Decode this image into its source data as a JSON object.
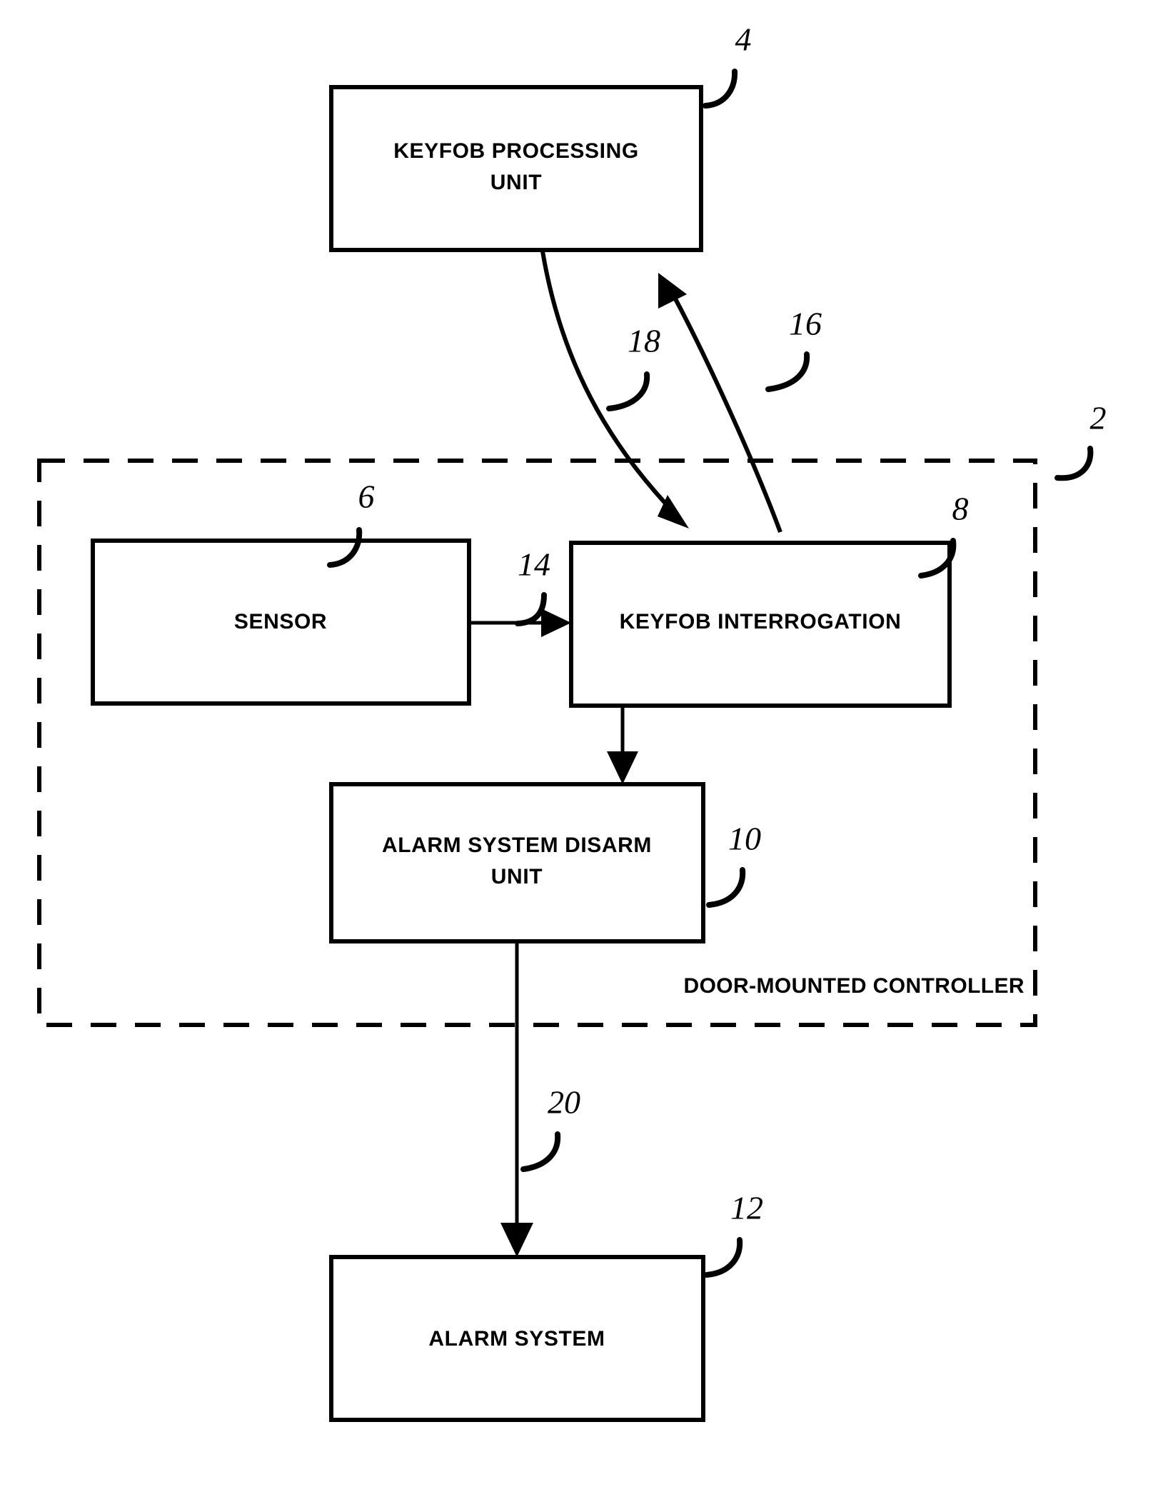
{
  "figure": {
    "type": "patent-block-diagram",
    "background_color": "#ffffff",
    "line_color": "#000000"
  },
  "boxes": [
    {
      "id": "keyfob-processing-unit",
      "label_line1": "KEYFOB PROCESSING",
      "label_line2": "UNIT",
      "ref": "4"
    },
    {
      "id": "sensor",
      "label_line1": "SENSOR",
      "label_line2": "",
      "ref": "6"
    },
    {
      "id": "keyfob-interrogation",
      "label_line1": "KEYFOB INTERROGATION",
      "label_line2": "",
      "ref": "8"
    },
    {
      "id": "alarm-system-disarm-unit",
      "label_line1": "ALARM SYSTEM DISARM",
      "label_line2": "UNIT",
      "ref": "10"
    },
    {
      "id": "alarm-system",
      "label_line1": "ALARM SYSTEM",
      "label_line2": "",
      "ref": "12"
    }
  ],
  "group": {
    "id": "door-mounted-controller",
    "label": "DOOR-MOUNTED CONTROLLER",
    "ref": "2",
    "style": "dashed"
  },
  "connectors": [
    {
      "id": "sensor-to-interrogation",
      "ref": "14",
      "from": "sensor",
      "to": "keyfob-interrogation",
      "style": "straight-arrow",
      "direction": "right"
    },
    {
      "id": "interrogation-to-processing-unit",
      "ref": "16",
      "from": "keyfob-interrogation",
      "to": "keyfob-processing-unit",
      "style": "curved-arrow",
      "direction": "up"
    },
    {
      "id": "processing-unit-to-interrogation",
      "ref": "18",
      "from": "keyfob-processing-unit",
      "to": "keyfob-interrogation",
      "style": "curved-arrow",
      "direction": "down"
    },
    {
      "id": "interrogation-to-disarm-unit",
      "ref": "",
      "from": "keyfob-interrogation",
      "to": "alarm-system-disarm-unit",
      "style": "straight-arrow",
      "direction": "down"
    },
    {
      "id": "disarm-unit-to-alarm-system",
      "ref": "20",
      "from": "alarm-system-disarm-unit",
      "to": "alarm-system",
      "style": "straight-arrow",
      "direction": "down"
    }
  ],
  "reference_numerals": {
    "n2": "2",
    "n4": "4",
    "n6": "6",
    "n8": "8",
    "n10": "10",
    "n12": "12",
    "n14": "14",
    "n16": "16",
    "n18": "18",
    "n20": "20"
  },
  "labels": {
    "keyfob_processing_unit_l1": "KEYFOB PROCESSING",
    "keyfob_processing_unit_l2": "UNIT",
    "sensor": "SENSOR",
    "keyfob_interrogation": "KEYFOB INTERROGATION",
    "alarm_system_disarm_unit_l1": "ALARM SYSTEM DISARM",
    "alarm_system_disarm_unit_l2": "UNIT",
    "alarm_system": "ALARM SYSTEM",
    "door_mounted_controller": "DOOR-MOUNTED CONTROLLER"
  }
}
